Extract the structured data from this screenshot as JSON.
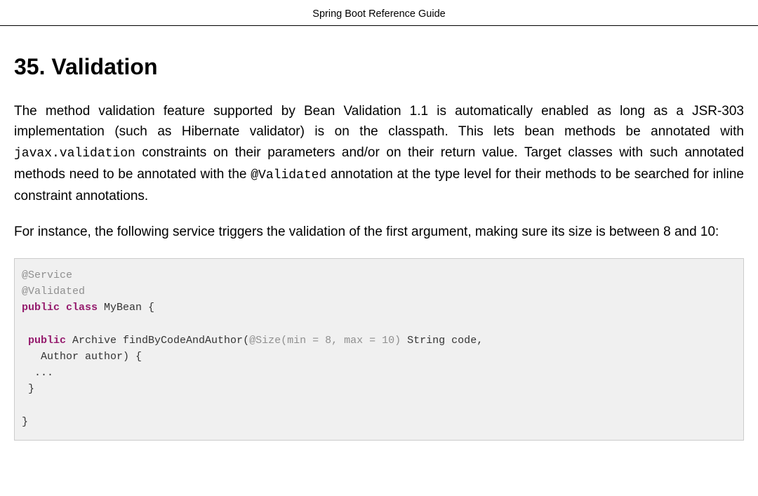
{
  "header": {
    "title": "Spring Boot Reference Guide"
  },
  "section": {
    "number": "35.",
    "title": "Validation"
  },
  "paragraphs": {
    "p1_pre": "The method validation feature supported by Bean Validation 1.1 is automatically enabled as long as a JSR-303 implementation (such as Hibernate validator) is on the classpath. This lets bean methods be annotated with ",
    "p1_code1": "javax.validation",
    "p1_mid": " constraints on their parameters and/or on their return value. Target classes with such annotated methods need to be annotated with the ",
    "p1_code2": "@Validated",
    "p1_post": " annotation at the type level for their methods to be searched for inline constraint annotations.",
    "p2": "For instance, the following service triggers the validation of the first argument, making sure its size is between 8 and 10:"
  },
  "code": {
    "ann_service": "@Service",
    "ann_validated": "@Validated",
    "kw_public1": "public",
    "kw_class": "class",
    "class_name": " MyBean {",
    "blank1": "",
    "kw_public2": " public",
    "ret_type": " Archive ",
    "method_name": "findByCodeAndAuthor",
    "paren_open": "(",
    "ann_size": "@Size",
    "size_args_open": "(min = ",
    "min_val": "8",
    "size_args_mid": ", max = ",
    "max_val": "10",
    "size_args_close": ")",
    "param1": " String code,",
    "param2_line": "   Author author) {",
    "ellipsis_line": "  ...",
    "brace_close1": " }",
    "blank2": "",
    "brace_close2": "}"
  }
}
